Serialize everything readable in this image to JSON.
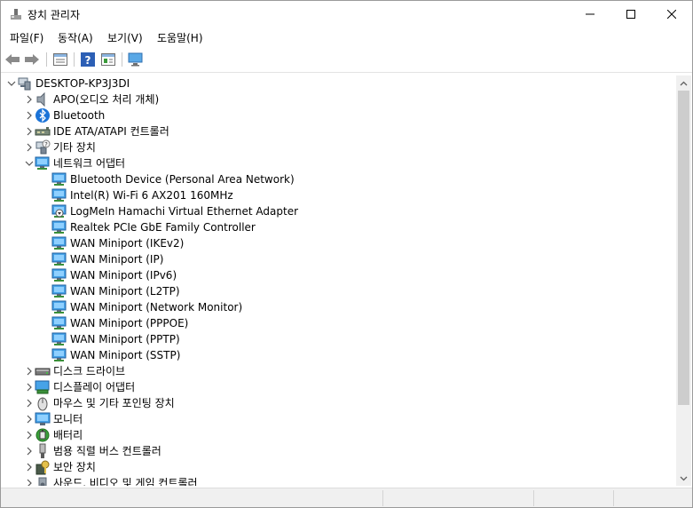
{
  "window": {
    "title": "장치 관리자"
  },
  "menu": [
    "파일(F)",
    "동작(A)",
    "보기(V)",
    "도움말(H)"
  ],
  "toolbar_icons": [
    "back-arrow-icon",
    "forward-arrow-icon",
    "properties-icon",
    "help-icon",
    "view-icon",
    "monitor-scan-icon"
  ],
  "tree": {
    "root": "DESKTOP-KP3J3DI",
    "categories_before": [
      {
        "label": "APO(오디오 처리 개체)",
        "icon": "speaker-icon"
      },
      {
        "label": "Bluetooth",
        "icon": "bluetooth-icon"
      },
      {
        "label": "IDE ATA/ATAPI 컨트롤러",
        "icon": "ide-controller-icon"
      },
      {
        "label": "기타 장치",
        "icon": "unknown-device-icon"
      }
    ],
    "network": {
      "label": "네트워크 어댑터",
      "children": [
        "Bluetooth Device (Personal Area Network)",
        "Intel(R) Wi-Fi 6 AX201 160MHz",
        "LogMeIn Hamachi Virtual Ethernet Adapter",
        "Realtek PCIe GbE Family Controller",
        "WAN Miniport (IKEv2)",
        "WAN Miniport (IP)",
        "WAN Miniport (IPv6)",
        "WAN Miniport (L2TP)",
        "WAN Miniport (Network Monitor)",
        "WAN Miniport (PPPOE)",
        "WAN Miniport (PPTP)",
        "WAN Miniport (SSTP)"
      ]
    },
    "categories_after": [
      {
        "label": "디스크 드라이브",
        "icon": "disk-drive-icon"
      },
      {
        "label": "디스플레이 어댑터",
        "icon": "display-adapter-icon"
      },
      {
        "label": "마우스 및 기타 포인팅 장치",
        "icon": "mouse-icon"
      },
      {
        "label": "모니터",
        "icon": "monitor-icon"
      },
      {
        "label": "배터리",
        "icon": "battery-icon"
      },
      {
        "label": "범용 직렬 버스 컨트롤러",
        "icon": "usb-icon"
      },
      {
        "label": "보안 장치",
        "icon": "security-device-icon"
      },
      {
        "label": "사운드, 비디오 및 게임 컨트롤러",
        "icon": "sound-icon"
      }
    ]
  },
  "colors": {
    "net": "#2f8fd6",
    "selection": "#cce8ff"
  }
}
